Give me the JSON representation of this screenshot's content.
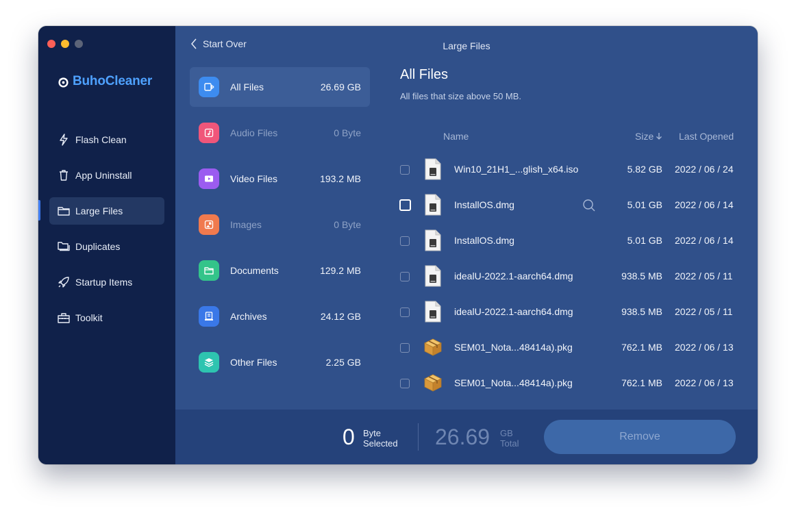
{
  "app": {
    "name": "BuhoCleaner",
    "window_title": "Large Files"
  },
  "sidebar": {
    "items": [
      {
        "label": "Flash Clean",
        "icon": "bolt-icon"
      },
      {
        "label": "App Uninstall",
        "icon": "trash-icon"
      },
      {
        "label": "Large Files",
        "icon": "folder-icon",
        "active": true
      },
      {
        "label": "Duplicates",
        "icon": "duplicate-folder-icon"
      },
      {
        "label": "Startup Items",
        "icon": "rocket-icon"
      },
      {
        "label": "Toolkit",
        "icon": "toolbox-icon"
      }
    ]
  },
  "header": {
    "back_label": "Start Over"
  },
  "categories": [
    {
      "label": "All Files",
      "size": "26.69 GB",
      "icon": "all-files-icon",
      "color": "#3d8cf0",
      "active": true
    },
    {
      "label": "Audio Files",
      "size": "0 Byte",
      "icon": "audio-icon",
      "color": "#f0567a",
      "dim": true
    },
    {
      "label": "Video Files",
      "size": "193.2 MB",
      "icon": "video-icon",
      "color": "#9b5cf0"
    },
    {
      "label": "Images",
      "size": "0 Byte",
      "icon": "image-icon",
      "color": "#f07a4e",
      "dim": true
    },
    {
      "label": "Documents",
      "size": "129.2 MB",
      "icon": "documents-icon",
      "color": "#34c48a"
    },
    {
      "label": "Archives",
      "size": "24.12 GB",
      "icon": "archive-icon",
      "color": "#3a78e8"
    },
    {
      "label": "Other Files",
      "size": "2.25 GB",
      "icon": "layers-icon",
      "color": "#2ec4b0"
    }
  ],
  "detail": {
    "title": "All Files",
    "subtitle": "All files that size above 50 MB.",
    "columns": {
      "name": "Name",
      "size": "Size",
      "last_opened": "Last Opened"
    }
  },
  "files": [
    {
      "name": "Win10_21H1_...glish_x64.iso",
      "size": "5.82 GB",
      "date": "2022 / 06 / 24",
      "icon": "disk-image-icon"
    },
    {
      "name": "InstallOS.dmg",
      "size": "5.01 GB",
      "date": "2022 / 06 / 14",
      "icon": "disk-image-icon",
      "hover": true
    },
    {
      "name": "InstallOS.dmg",
      "size": "5.01 GB",
      "date": "2022 / 06 / 14",
      "icon": "disk-image-icon"
    },
    {
      "name": "idealU-2022.1-aarch64.dmg",
      "size": "938.5 MB",
      "date": "2022 / 05 / 11",
      "icon": "disk-image-icon"
    },
    {
      "name": "idealU-2022.1-aarch64.dmg",
      "size": "938.5 MB",
      "date": "2022 / 05 / 11",
      "icon": "disk-image-icon"
    },
    {
      "name": "SEM01_Nota...48414a).pkg",
      "size": "762.1 MB",
      "date": "2022 / 06 / 13",
      "icon": "package-icon"
    },
    {
      "name": "SEM01_Nota...48414a).pkg",
      "size": "762.1 MB",
      "date": "2022 / 06 / 13",
      "icon": "package-icon"
    }
  ],
  "footer": {
    "selected_value": "0",
    "selected_unit": "Byte",
    "selected_label": "Selected",
    "total_value": "26.69",
    "total_unit": "GB",
    "total_label": "Total",
    "remove_label": "Remove"
  }
}
